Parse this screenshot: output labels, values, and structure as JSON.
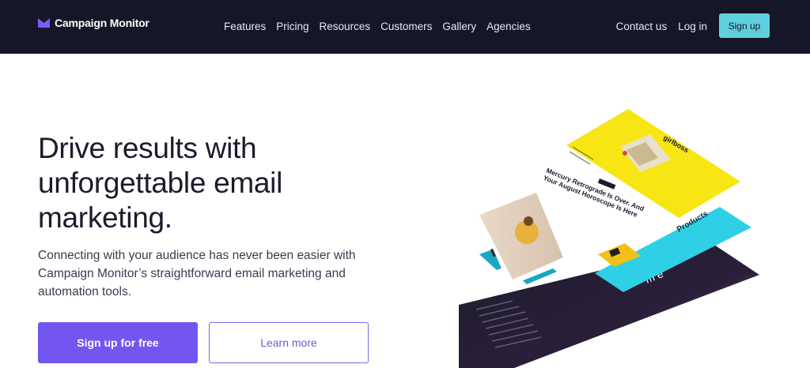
{
  "nav": {
    "brand": "Campaign Monitor",
    "links": [
      "Features",
      "Pricing",
      "Resources",
      "Customers",
      "Gallery",
      "Agencies"
    ],
    "contact": "Contact us",
    "login": "Log in",
    "signup": "Sign up"
  },
  "hero": {
    "title": "Drive results with unforgettable email marketing.",
    "subtitle": "Connecting with your audience has never been easier with Campaign Monitor’s straightforward email marketing and automation tools.",
    "primary_cta": "Sign up for free",
    "secondary_cta": "Learn more"
  },
  "illustration": {
    "brand_word": "girlboss",
    "headline": "Mercury Retrograde Is Over. And Your August Horoscope Is Here",
    "products_label": "Products"
  },
  "colors": {
    "nav_bg": "#161629",
    "accent_purple": "#7356f0",
    "signup_cyan": "#5ed0dd",
    "yellow": "#f7e614",
    "cyan": "#2fd0e6"
  }
}
